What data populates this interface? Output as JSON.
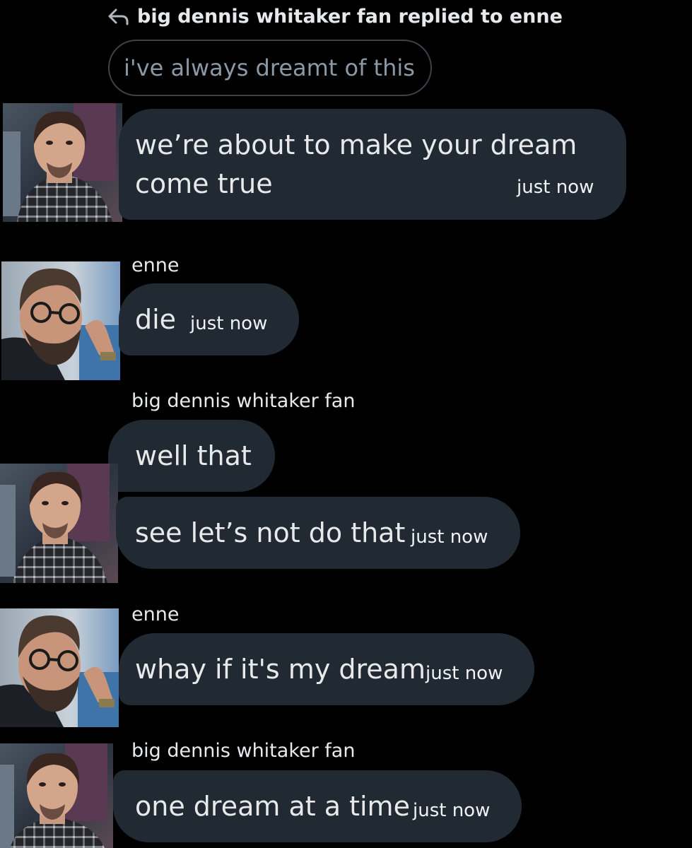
{
  "reply": {
    "header": "big dennis whitaker fan replied to enne",
    "quoted_text": "i've always dreamt of this"
  },
  "messages": [
    {
      "line1": "we’re about to make your dream",
      "line2": "come true",
      "time": "just now"
    },
    {
      "sender": "enne",
      "text": "die",
      "time": "just now"
    },
    {
      "sender": "big dennis whitaker fan",
      "text": "well that"
    },
    {
      "text": "see let’s not do that",
      "time": "just now"
    },
    {
      "sender": "enne",
      "text": "whay if it's my dream",
      "time": "just now"
    },
    {
      "sender": "big dennis whitaker fan",
      "text": "one dream at a time",
      "time": "just now"
    }
  ],
  "icons": {
    "reply": "reply-arrow-icon"
  },
  "colors": {
    "background": "#000000",
    "bubble": "#212a33",
    "text": "#e7e9ea",
    "muted": "#8b98a5",
    "quote_border": "#3d4349"
  }
}
